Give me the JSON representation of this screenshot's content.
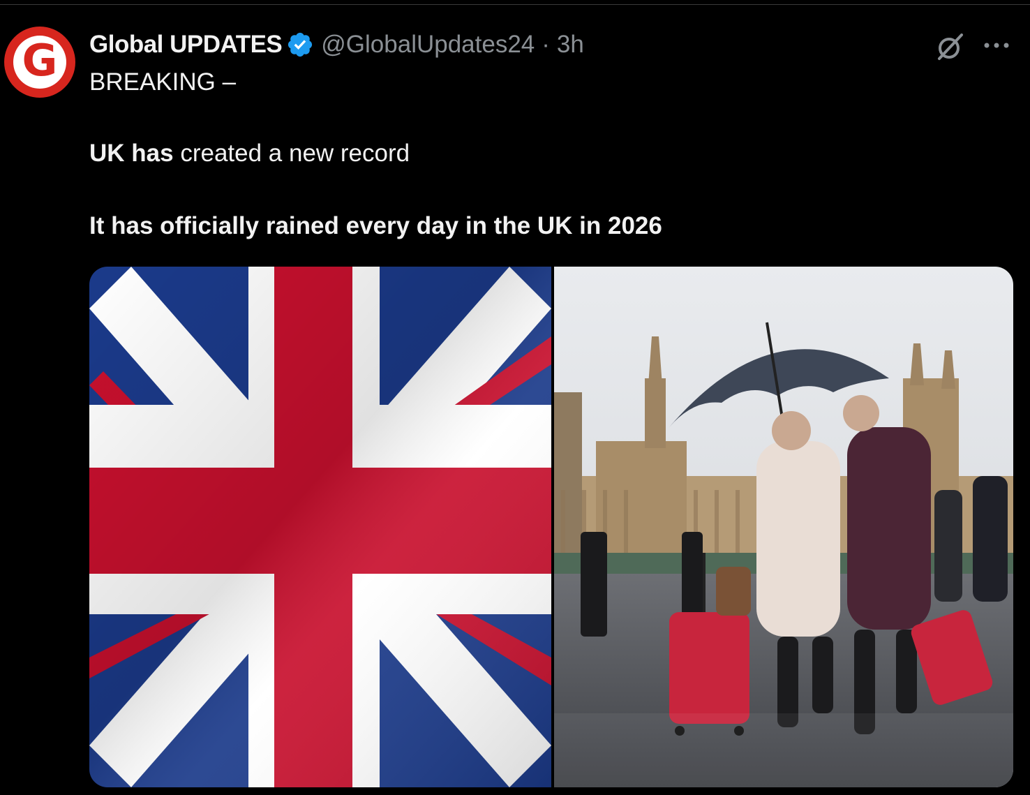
{
  "post": {
    "author": {
      "name": "Global UPDATES",
      "handle": "@GlobalUpdates24",
      "separator": "·",
      "time": "3h",
      "avatar_letter": "G",
      "verified": true
    },
    "text": {
      "line1": "BREAKING –",
      "line2_bold": "UK has",
      "line2_rest": " created a new record",
      "line3": "It has officially rained every day in the UK in 2026"
    },
    "actions": {
      "grok_icon": "grok-icon",
      "more_icon": "more-icon"
    },
    "media": [
      {
        "kind": "image",
        "subject": "union-jack-flag"
      },
      {
        "kind": "image",
        "subject": "london-rain-photo"
      }
    ]
  },
  "colors": {
    "background": "#000000",
    "text": "#e7e9ea",
    "muted": "#8b9095",
    "verified": "#1d9bf0",
    "brand_red": "#d7261e"
  }
}
